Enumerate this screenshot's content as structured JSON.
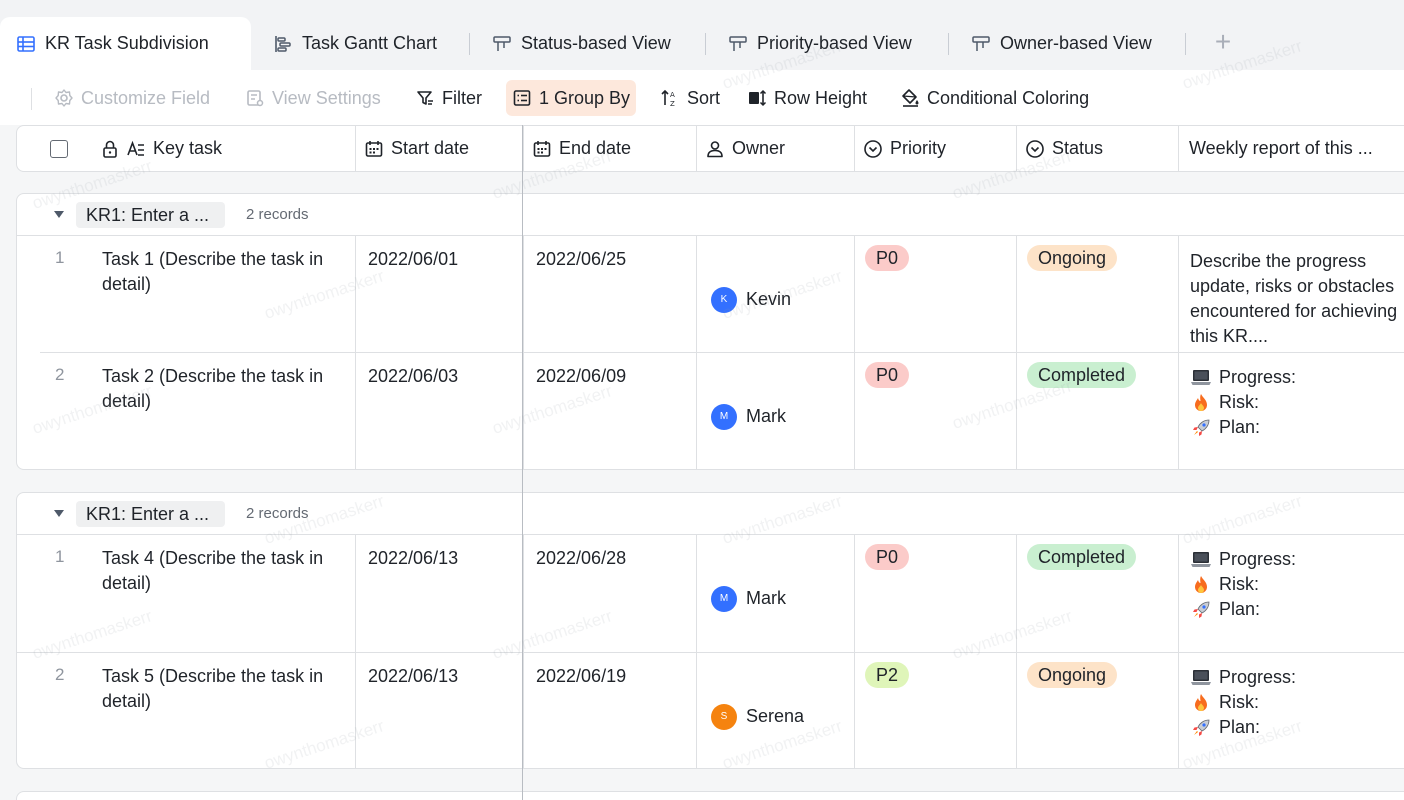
{
  "tabs": [
    {
      "label": "KR Task Subdivision",
      "icon": "grid-table-icon",
      "active": true
    },
    {
      "label": "Task Gantt Chart",
      "icon": "gantt-icon",
      "active": false
    },
    {
      "label": "Status-based View",
      "icon": "kanban-icon",
      "active": false
    },
    {
      "label": "Priority-based View",
      "icon": "kanban-icon",
      "active": false
    },
    {
      "label": "Owner-based View",
      "icon": "kanban-icon",
      "active": false
    }
  ],
  "add_tab_glyph": "+",
  "toolbar": {
    "customize_field": "Customize Field",
    "view_settings": "View Settings",
    "filter": "Filter",
    "group_by": "1 Group By",
    "sort": "Sort",
    "row_height": "Row Height",
    "conditional_coloring": "Conditional Coloring"
  },
  "columns": {
    "key_task": "Key task",
    "start_date": "Start date",
    "end_date": "End date",
    "owner": "Owner",
    "priority": "Priority",
    "status": "Status",
    "weekly": "Weekly report of this ..."
  },
  "groups": [
    {
      "label": "KR1: Enter a ...",
      "count": "2 records",
      "rows": [
        {
          "num": "1",
          "task": "Task 1 (Describe the task in detail)",
          "start": "2022/06/01",
          "end": "2022/06/25",
          "owner": "Kevin",
          "owner_initial": "K",
          "owner_color": "#3370ff",
          "priority": "P0",
          "status": "Ongoing",
          "weekly_text": "Describe the progress update, risks or obstacles encountered for achieving this KR...."
        },
        {
          "num": "2",
          "task": "Task 2 (Describe the task in detail)",
          "start": "2022/06/03",
          "end": "2022/06/09",
          "owner": "Mark",
          "owner_initial": "M",
          "owner_color": "#3370ff",
          "priority": "P0",
          "status": "Completed",
          "weekly_lines": [
            "Progress:",
            "Risk:",
            "Plan:"
          ]
        }
      ]
    },
    {
      "label": "KR1: Enter a ...",
      "count": "2 records",
      "rows": [
        {
          "num": "1",
          "task": "Task 4 (Describe the task in detail)",
          "start": "2022/06/13",
          "end": "2022/06/28",
          "owner": "Mark",
          "owner_initial": "M",
          "owner_color": "#3370ff",
          "priority": "P0",
          "status": "Completed",
          "weekly_lines": [
            "Progress:",
            "Risk:",
            "Plan:"
          ]
        },
        {
          "num": "2",
          "task": "Task 5 (Describe the task in detail)",
          "start": "2022/06/13",
          "end": "2022/06/19",
          "owner": "Serena",
          "owner_initial": "S",
          "owner_color": "#f5830f",
          "priority": "P2",
          "status": "Ongoing",
          "weekly_lines": [
            "Progress:",
            "Risk:",
            "Plan:"
          ]
        }
      ]
    }
  ],
  "colors": {
    "p0_bg": "#fbcbc9",
    "p2_bg": "#dff5b9",
    "ongoing_bg": "#fde3c8",
    "completed_bg": "#c9efd0",
    "accent": "#3370ff"
  },
  "watermark": "owynthomaskerr"
}
